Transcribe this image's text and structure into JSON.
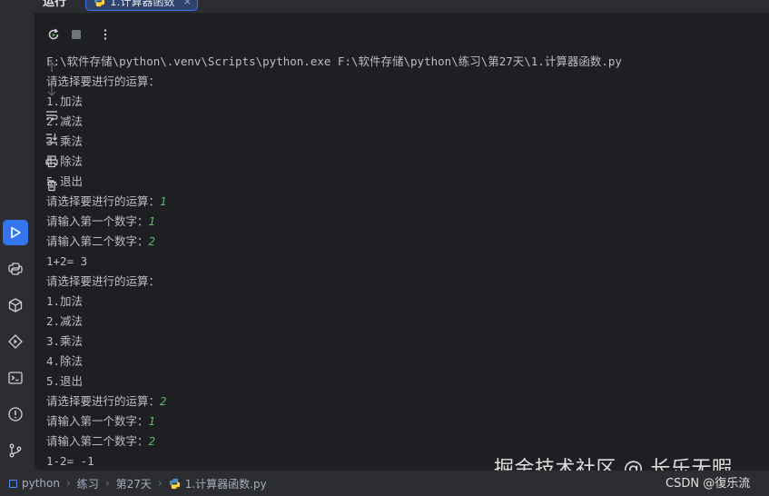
{
  "window": {
    "title": "运行",
    "run_tab_label": "1.计算器函数",
    "run_tab_close": "×"
  },
  "console": {
    "lines": [
      {
        "text": "F:\\软件存储\\python\\.venv\\Scripts\\python.exe F:\\软件存储\\python\\练习\\第27天\\1.计算器函数.py",
        "input": ""
      },
      {
        "text": "请选择要进行的运算：",
        "input": ""
      },
      {
        "text": "1.加法",
        "input": ""
      },
      {
        "text": "2.减法",
        "input": ""
      },
      {
        "text": "3.乘法",
        "input": ""
      },
      {
        "text": "4.除法",
        "input": ""
      },
      {
        "text": "5.退出",
        "input": ""
      },
      {
        "text": "请选择要进行的运算：",
        "input": "1"
      },
      {
        "text": "请输入第一个数字：",
        "input": "1"
      },
      {
        "text": "请输入第二个数字：",
        "input": "2"
      },
      {
        "text": "1+2= 3",
        "input": ""
      },
      {
        "text": "请选择要进行的运算：",
        "input": ""
      },
      {
        "text": "1.加法",
        "input": ""
      },
      {
        "text": "2.减法",
        "input": ""
      },
      {
        "text": "3.乘法",
        "input": ""
      },
      {
        "text": "4.除法",
        "input": ""
      },
      {
        "text": "5.退出",
        "input": ""
      },
      {
        "text": "请选择要进行的运算：",
        "input": "2"
      },
      {
        "text": "请输入第一个数字：",
        "input": "1"
      },
      {
        "text": "请输入第二个数字：",
        "input": "2"
      },
      {
        "text": "1-2= -1",
        "input": ""
      }
    ]
  },
  "breadcrumb": {
    "items": [
      "python",
      "练习",
      "第27天",
      "1.计算器函数.py"
    ]
  },
  "watermark": {
    "text": "掘金技术社区 @ 长乐无暇",
    "csdn": "CSDN @復乐流"
  },
  "colors": {
    "background": "#1e1f22",
    "panel": "#2b2d30",
    "text": "#bcbec4",
    "user_input": "#5fb865",
    "accent": "#3574f0"
  },
  "icons": {
    "toolbar": [
      "rerun-icon",
      "stop-icon",
      "more-options-icon"
    ],
    "side": [
      "scroll-up-icon",
      "scroll-down-icon",
      "soft-wrap-icon",
      "scroll-to-end-icon",
      "print-icon",
      "clear-all-icon"
    ],
    "activity": [
      "run-icon",
      "python-console-icon",
      "python-packages-icon",
      "services-icon",
      "terminal-icon",
      "problems-icon",
      "git-icon"
    ]
  }
}
